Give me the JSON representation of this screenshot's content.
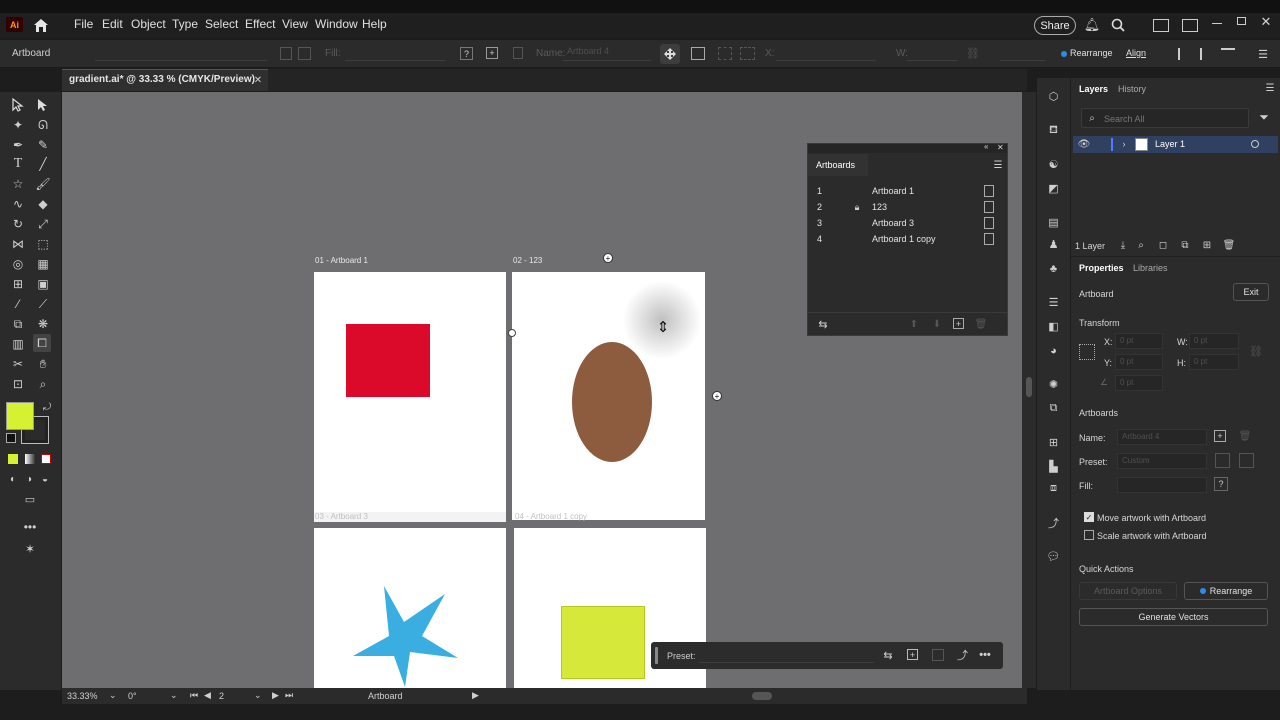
{
  "app": {
    "logo": "Ai"
  },
  "menu": [
    "File",
    "Edit",
    "Object",
    "Type",
    "Select",
    "Effect",
    "View",
    "Window",
    "Help"
  ],
  "topright": {
    "share_label": "Share"
  },
  "control_bar": {
    "mode_label": "Artboard",
    "fill_label": "Fill:",
    "name_label": "Name:",
    "name_value": "Artboard 4",
    "x_label": "X:",
    "w_label": "W:",
    "rearrange_label": "Rearrange",
    "align_label": "Align"
  },
  "document": {
    "tab_title": "gradient.ai* @ 33.33 % (CMYK/Preview)"
  },
  "canvas": {
    "artboards": [
      {
        "label": "01 - Artboard 1"
      },
      {
        "label": "02 - 123"
      },
      {
        "label": "03 - Artboard 3"
      },
      {
        "label": "04 - Artboard 1 copy"
      }
    ],
    "colors": {
      "red": "#dc0a2a",
      "brown": "#8d5b3e",
      "star": "#3aaee0",
      "lime": "#d6e83a",
      "fill_swatch": "#d6f032"
    }
  },
  "status": {
    "zoom": "33.33%",
    "rotation": "0°",
    "artboard_num": "2",
    "tool_name": "Artboard"
  },
  "artboards_panel": {
    "title": "Artboards",
    "rows": [
      {
        "num": "1",
        "name": "Artboard 1"
      },
      {
        "num": "2",
        "name": "123"
      },
      {
        "num": "3",
        "name": "Artboard 3"
      },
      {
        "num": "4",
        "name": "Artboard 1 copy"
      }
    ]
  },
  "layers_panel": {
    "tabs": [
      "Layers",
      "History"
    ],
    "search_placeholder": "Search All",
    "layer_name": "Layer 1",
    "count": "1 Layer"
  },
  "properties_panel": {
    "tabs": [
      "Properties",
      "Libraries"
    ],
    "section": "Artboard",
    "exit_label": "Exit",
    "transform_title": "Transform",
    "x_label": "X:",
    "x_value": "0 pt",
    "y_label": "Y:",
    "y_value": "0 pt",
    "w_label": "W:",
    "w_value": "0 pt",
    "h_label": "H:",
    "h_value": "0 pt",
    "angle_value": "0 pt",
    "artboards_title": "Artboards",
    "name_label": "Name:",
    "name_value": "Artboard 4",
    "preset_label": "Preset:",
    "preset_value": "Custom",
    "fill_label": "Fill:",
    "move_artwork": "Move artwork with Artboard",
    "scale_artwork": "Scale artwork with Artboard",
    "quick_actions_title": "Quick Actions",
    "artboard_options": "Artboard Options",
    "rearrange": "Rearrange",
    "generate_vectors": "Generate Vectors"
  },
  "preset_bar": {
    "label": "Preset:"
  }
}
